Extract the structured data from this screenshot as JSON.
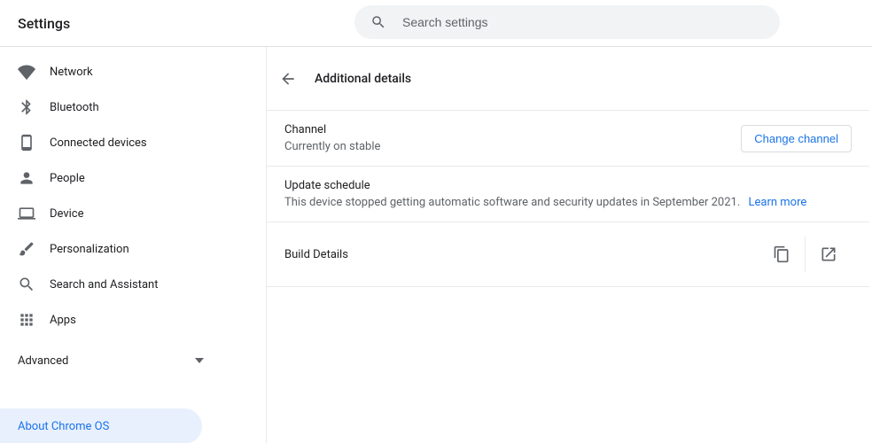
{
  "header": {
    "title": "Settings"
  },
  "search": {
    "placeholder": "Search settings"
  },
  "sidebar": {
    "items": [
      {
        "label": "Network"
      },
      {
        "label": "Bluetooth"
      },
      {
        "label": "Connected devices"
      },
      {
        "label": "People"
      },
      {
        "label": "Device"
      },
      {
        "label": "Personalization"
      },
      {
        "label": "Search and Assistant"
      },
      {
        "label": "Apps"
      }
    ],
    "advanced_label": "Advanced",
    "about_label": "About Chrome OS"
  },
  "main": {
    "page_title": "Additional details",
    "channel": {
      "title": "Channel",
      "sub": "Currently on stable",
      "button": "Change channel"
    },
    "update": {
      "title": "Update schedule",
      "sub": "This device stopped getting automatic software and security updates in September 2021.",
      "link": "Learn more"
    },
    "build": {
      "title": "Build Details"
    }
  }
}
